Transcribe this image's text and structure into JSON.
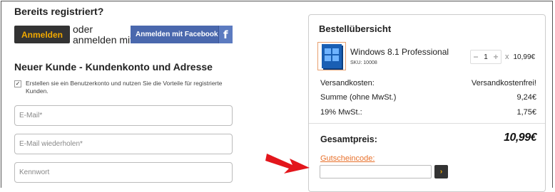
{
  "login": {
    "heading": "Bereits registriert?",
    "login_button": "Anmelden",
    "or_text_line1": "oder",
    "or_text_line2": "anmelden mit",
    "facebook_button": "Anmelden mit Facebook",
    "facebook_icon_glyph": "f"
  },
  "register": {
    "heading": "Neuer Kunde - Kundenkonto und Adresse",
    "checkbox_checked": true,
    "checkbox_glyph": "✓",
    "checkbox_label": "Erstellen sie ein Benutzerkonto und nutzen Sie die Vorteile für registrierte Kunden.",
    "fields": {
      "email_placeholder": "E-Mail*",
      "email_repeat_placeholder": "E-Mail wiederholen*",
      "password_placeholder": "Kennwort"
    }
  },
  "order": {
    "title": "Bestellübersicht",
    "product": {
      "name": "Windows 8.1 Professional",
      "sku": "SKU: 10008",
      "quantity": "1",
      "minus": "−",
      "plus": "+",
      "times": "x",
      "price": "10,99€"
    },
    "rows": [
      {
        "label": "Versandkosten:",
        "value": "Versandkostenfrei!"
      },
      {
        "label": "Summe (ohne MwSt.)",
        "value": "9,24€"
      },
      {
        "label": "19% MwSt.:",
        "value": "1,75€"
      }
    ],
    "total_label": "Gesamtpreis:",
    "total_value": "10,99€",
    "coupon_label": "Gutscheincode:",
    "coupon_button_glyph": "›"
  },
  "colors": {
    "accent": "#f2a900",
    "facebook": "#4a68ad",
    "coupon_link": "#e8702a",
    "arrow": "#e3161c"
  },
  "icons": {
    "product_image": "windows-logo-icon",
    "facebook": "facebook-icon",
    "checkbox": "check-icon",
    "coupon_submit": "chevron-right-icon",
    "annotation": "red-arrow-icon"
  }
}
